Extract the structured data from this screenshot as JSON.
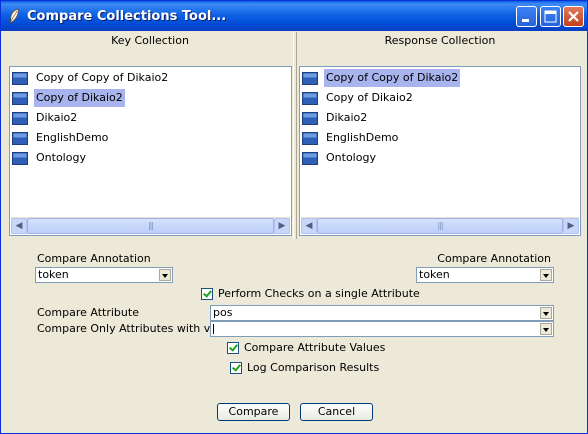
{
  "window": {
    "title": "Compare Collections Tool..."
  },
  "key_panel": {
    "header": "Key Collection",
    "items": [
      {
        "label": "Copy of Copy of Dikaio2",
        "selected": false
      },
      {
        "label": "Copy of Dikaio2",
        "selected": true
      },
      {
        "label": "Dikaio2",
        "selected": false
      },
      {
        "label": "EnglishDemo",
        "selected": false
      },
      {
        "label": "Ontology",
        "selected": false
      }
    ]
  },
  "response_panel": {
    "header": "Response Collection",
    "items": [
      {
        "label": "Copy of Copy of Dikaio2",
        "selected": true
      },
      {
        "label": "Copy of Dikaio2",
        "selected": false
      },
      {
        "label": "Dikaio2",
        "selected": false
      },
      {
        "label": "EnglishDemo",
        "selected": false
      },
      {
        "label": "Ontology",
        "selected": false
      }
    ]
  },
  "options": {
    "compare_annotation_left_label": "Compare Annotation",
    "compare_annotation_left_value": "token",
    "compare_annotation_right_label": "Compare Annotation",
    "compare_annotation_right_value": "token",
    "perform_checks_label": "Perform Checks on a single Attribute",
    "perform_checks_checked": true,
    "compare_attribute_label": "Compare Attribute",
    "compare_attribute_value": "pos",
    "compare_only_label": "Compare Only Attributes with values:",
    "compare_only_value": "",
    "compare_values_label": "Compare Attribute Values",
    "compare_values_checked": true,
    "log_results_label": "Log Comparison Results",
    "log_results_checked": true
  },
  "buttons": {
    "compare": "Compare",
    "cancel": "Cancel"
  },
  "colors": {
    "titlebar": "#0a5fe8",
    "selection": "#a8b4ee",
    "face": "#ece9d8"
  }
}
